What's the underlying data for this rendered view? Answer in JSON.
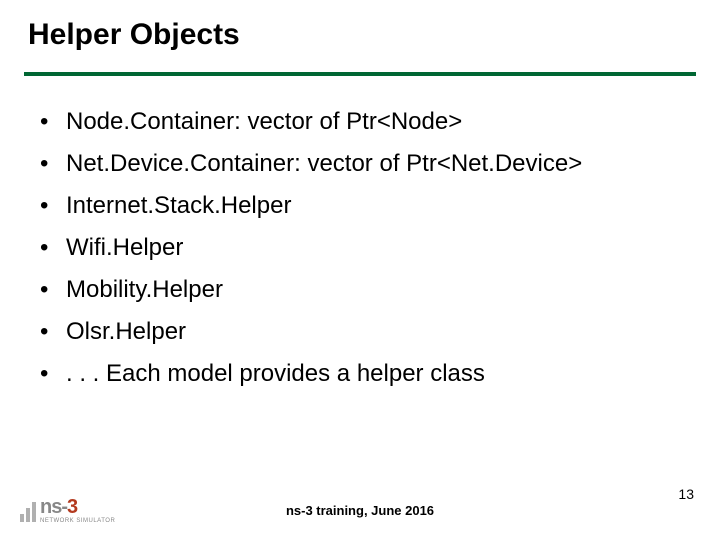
{
  "title": "Helper Objects",
  "bullets": [
    "Node.Container: vector of Ptr<Node>",
    "Net.Device.Container: vector of Ptr<Net.Device>",
    "Internet.Stack.Helper",
    "Wifi.Helper",
    "Mobility.Helper",
    "Olsr.Helper",
    ". . . Each model provides a helper class"
  ],
  "footer": "ns-3 training, June 2016",
  "page_number": "13",
  "logo": {
    "ns": "ns-",
    "three": "3",
    "sub": "NETWORK SIMULATOR"
  }
}
